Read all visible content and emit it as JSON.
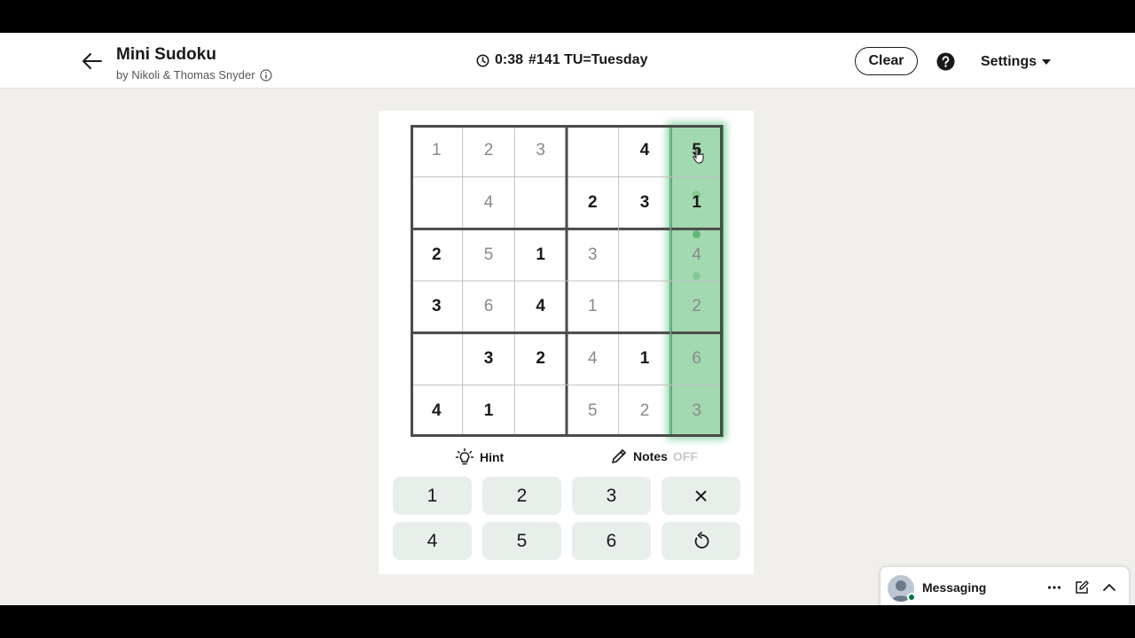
{
  "header": {
    "title": "Mini Sudoku",
    "byline": "by Nikoli & Thomas Snyder",
    "timer": "0:38",
    "puzzle": "#141 TU=Tuesday",
    "clear_label": "Clear",
    "settings_label": "Settings"
  },
  "board": {
    "rows": [
      [
        {
          "v": "1",
          "t": "user"
        },
        {
          "v": "2",
          "t": "user"
        },
        {
          "v": "3",
          "t": "user"
        },
        {
          "v": "",
          "t": "empty"
        },
        {
          "v": "4",
          "t": "given"
        },
        {
          "v": "5",
          "t": "given"
        }
      ],
      [
        {
          "v": "",
          "t": "empty"
        },
        {
          "v": "4",
          "t": "user"
        },
        {
          "v": "",
          "t": "empty"
        },
        {
          "v": "2",
          "t": "given"
        },
        {
          "v": "3",
          "t": "given"
        },
        {
          "v": "1",
          "t": "given"
        }
      ],
      [
        {
          "v": "2",
          "t": "given"
        },
        {
          "v": "5",
          "t": "user"
        },
        {
          "v": "1",
          "t": "given"
        },
        {
          "v": "3",
          "t": "user"
        },
        {
          "v": "",
          "t": "empty"
        },
        {
          "v": "4",
          "t": "user"
        }
      ],
      [
        {
          "v": "3",
          "t": "given"
        },
        {
          "v": "6",
          "t": "user"
        },
        {
          "v": "4",
          "t": "given"
        },
        {
          "v": "1",
          "t": "user"
        },
        {
          "v": "",
          "t": "empty"
        },
        {
          "v": "2",
          "t": "user"
        }
      ],
      [
        {
          "v": "",
          "t": "empty"
        },
        {
          "v": "3",
          "t": "given"
        },
        {
          "v": "2",
          "t": "given"
        },
        {
          "v": "4",
          "t": "user"
        },
        {
          "v": "1",
          "t": "given"
        },
        {
          "v": "6",
          "t": "user"
        }
      ],
      [
        {
          "v": "4",
          "t": "given"
        },
        {
          "v": "1",
          "t": "given"
        },
        {
          "v": "",
          "t": "empty"
        },
        {
          "v": "5",
          "t": "user"
        },
        {
          "v": "2",
          "t": "user"
        },
        {
          "v": "3",
          "t": "user"
        }
      ]
    ],
    "highlighted_column": 5,
    "highlight_color": "#39a85c"
  },
  "controls": {
    "hint_label": "Hint",
    "notes_label": "Notes",
    "notes_state": "OFF"
  },
  "keypad": {
    "keys": [
      "1",
      "2",
      "3",
      "×",
      "4",
      "5",
      "6",
      "undo-icon"
    ]
  },
  "messaging": {
    "label": "Messaging"
  },
  "colors": {
    "accent": "#39a85c",
    "key_bg": "#e8efeb",
    "page_bg": "#f1efec"
  }
}
